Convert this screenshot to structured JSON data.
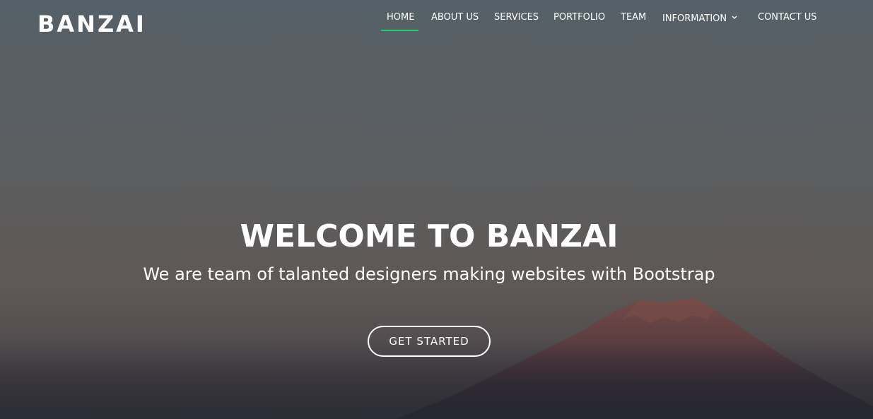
{
  "brand": {
    "logo_text": "BANZAI"
  },
  "nav": {
    "items": [
      {
        "label": "HOME",
        "active": true
      },
      {
        "label": "ABOUT US",
        "active": false
      },
      {
        "label": "SERVICES",
        "active": false
      },
      {
        "label": "PORTFOLIO",
        "active": false
      },
      {
        "label": "TEAM",
        "active": false
      },
      {
        "label": "INFORMATION",
        "active": false,
        "has_dropdown": true
      },
      {
        "label": "CONTACT US",
        "active": false
      }
    ],
    "active_color": "#18d26e"
  },
  "hero": {
    "title": "WELCOME TO BANZAI",
    "subtitle": "We are team of talanted designers making websites with Bootstrap",
    "cta_label": "GET STARTED"
  },
  "icons": {
    "dropdown": "chevron-down-icon"
  }
}
